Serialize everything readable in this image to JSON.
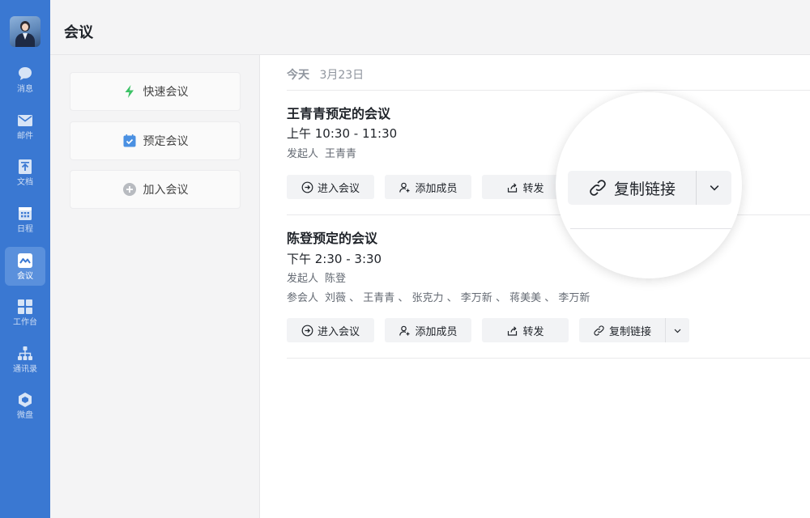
{
  "nav": {
    "items": [
      {
        "label": "消息",
        "icon": "chat-bubble-icon"
      },
      {
        "label": "邮件",
        "icon": "mail-icon"
      },
      {
        "label": "文档",
        "icon": "document-icon"
      },
      {
        "label": "日程",
        "icon": "calendar-icon"
      },
      {
        "label": "会议",
        "icon": "meeting-icon",
        "active": true
      },
      {
        "label": "工作台",
        "icon": "grid-icon"
      },
      {
        "label": "通讯录",
        "icon": "org-chart-icon"
      },
      {
        "label": "微盘",
        "icon": "cloud-drive-icon"
      }
    ]
  },
  "header": {
    "title": "会议"
  },
  "actions": [
    {
      "label": "快速会议",
      "icon": "lightning-icon",
      "color": "#3cc266"
    },
    {
      "label": "预定会议",
      "icon": "calendar-check-icon",
      "color": "#4a90e2"
    },
    {
      "label": "加入会议",
      "icon": "plus-circle-icon",
      "color": "#b8bbc0"
    }
  ],
  "main": {
    "today_label": "今天",
    "date": "3月23日",
    "meetings": [
      {
        "title": "王青青预定的会议",
        "time": "上午 10:30 - 11:30",
        "organizer_label": "发起人",
        "organizer": "王青青"
      },
      {
        "title": "陈登预定的会议",
        "time": "下午 2:30 - 3:30",
        "organizer_label": "发起人",
        "organizer": "陈登",
        "attendees_label": "参会人",
        "attendees": "刘薇 、 王青青 、 张克力 、 李万新 、 蒋美美 、 李万新"
      }
    ],
    "buttons": {
      "enter": "进入会议",
      "add_member": "添加成员",
      "forward": "转发",
      "copy_link": "复制链接"
    }
  },
  "colors": {
    "rail": "#3a78d2",
    "rail_active": "#5a90dc",
    "panel_bg": "#f4f4f5",
    "button_bg": "#f2f3f5"
  }
}
